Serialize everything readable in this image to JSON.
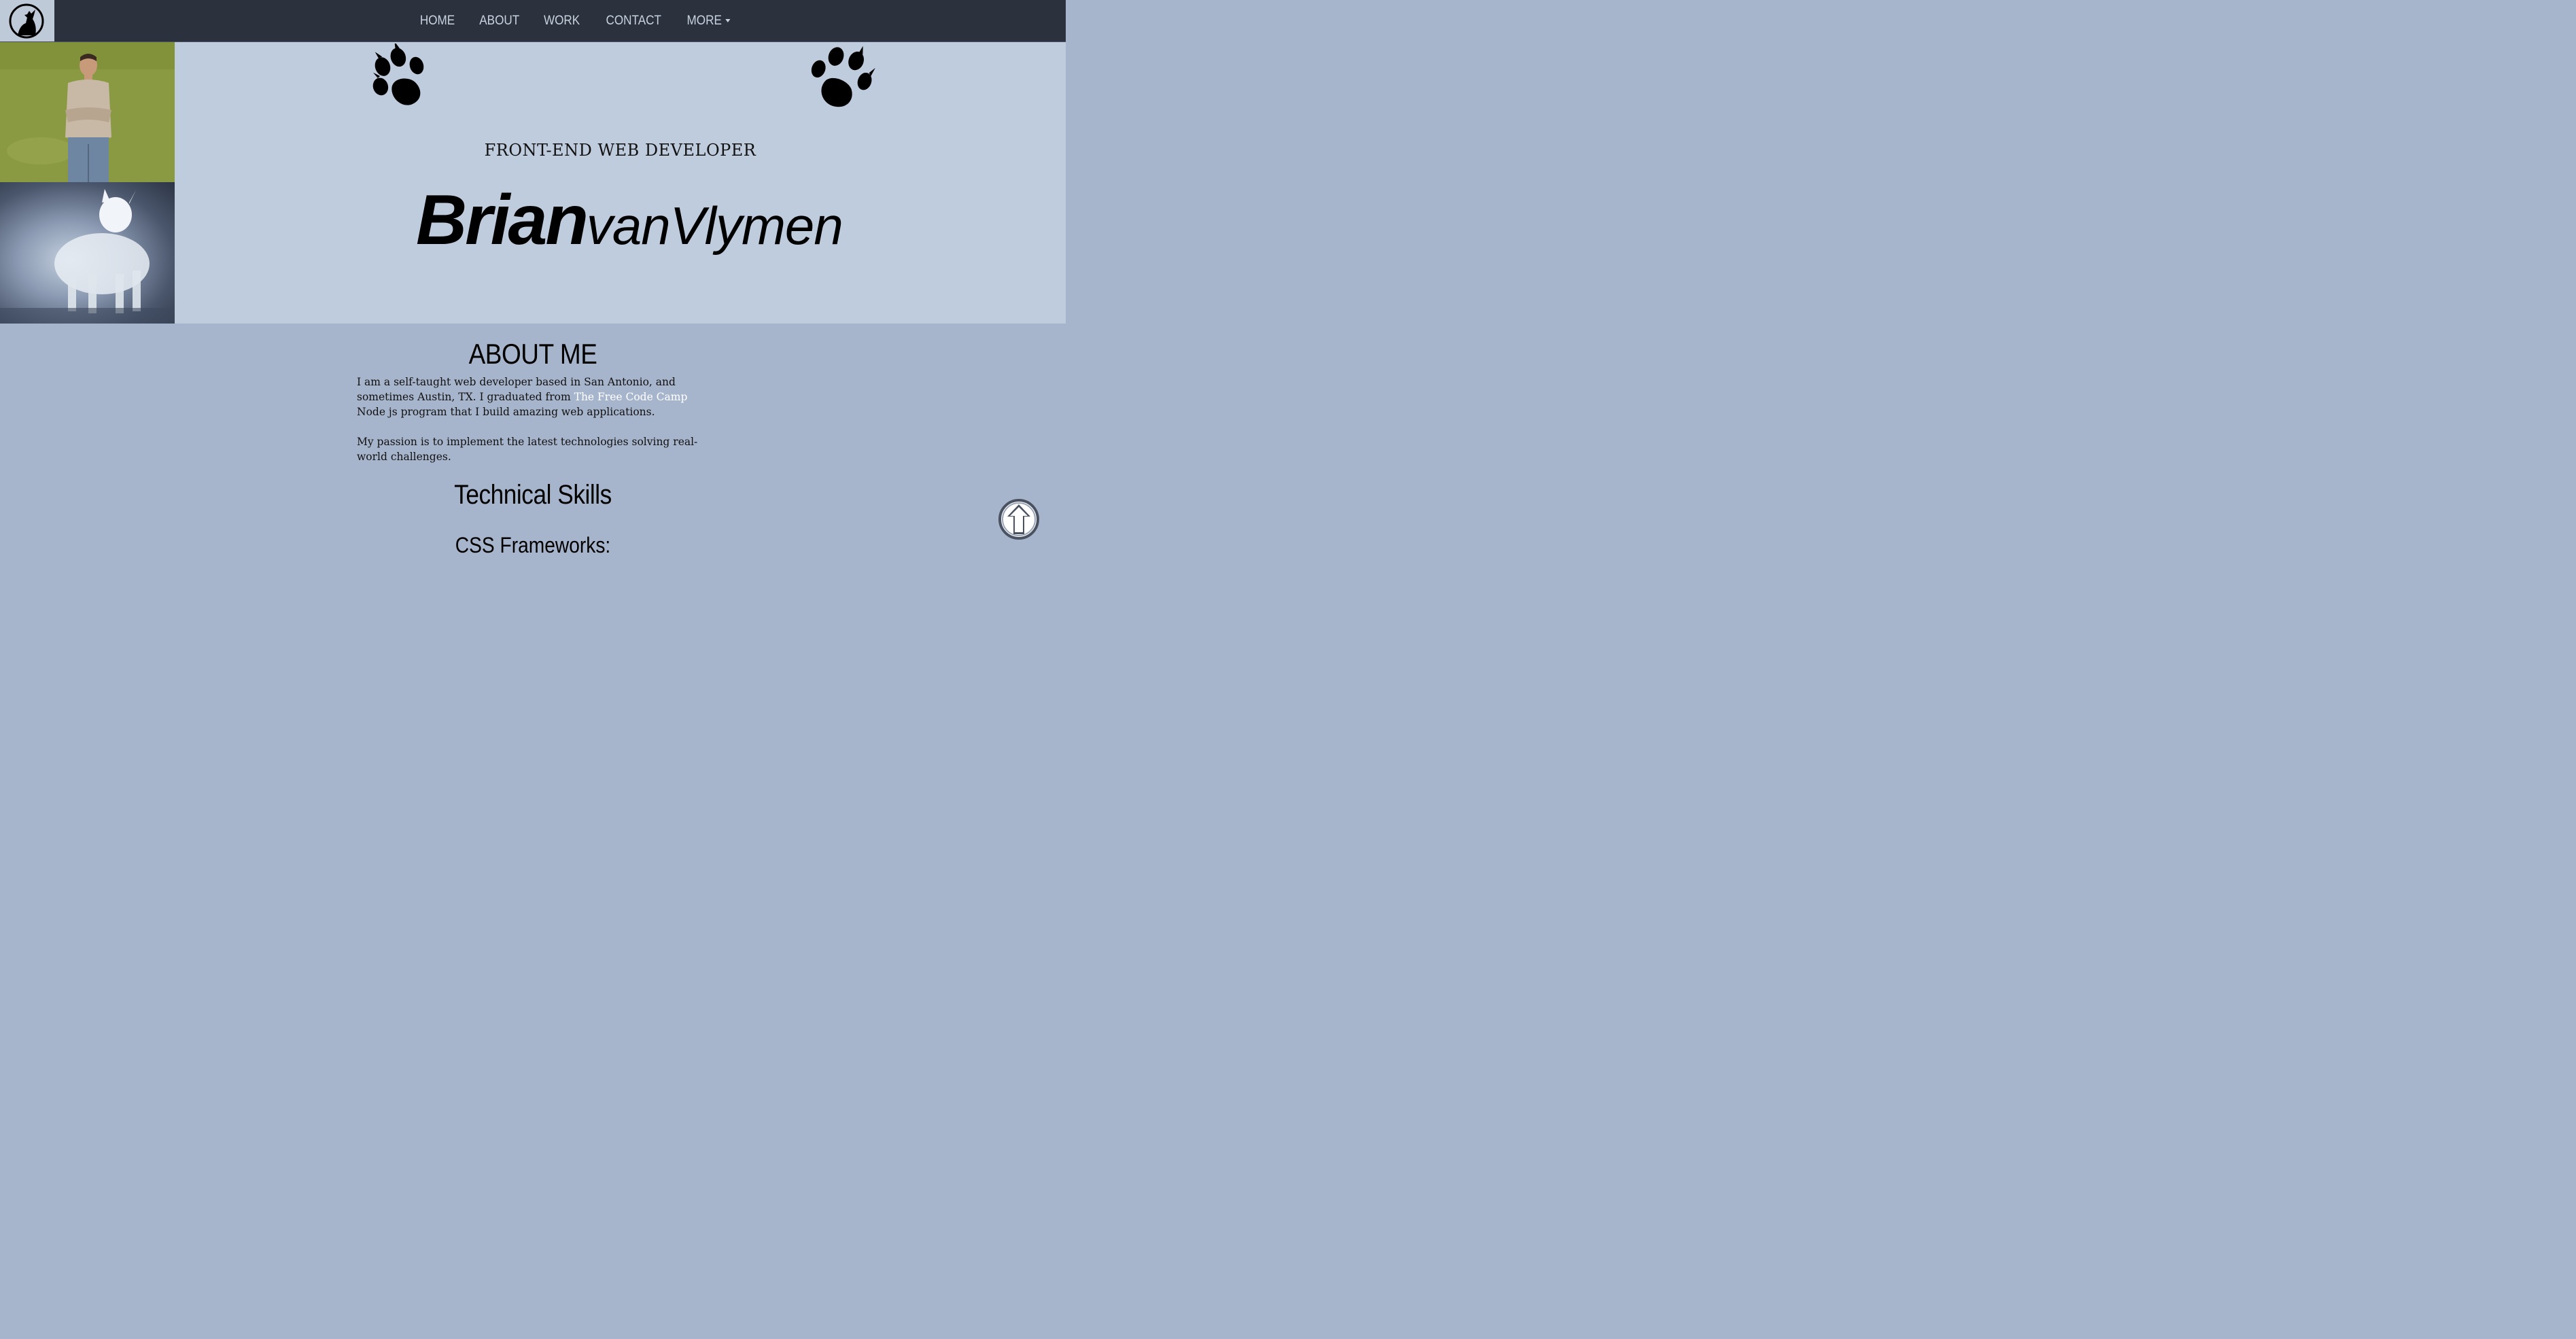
{
  "header": {
    "logo_icon": "howling-wolf-icon",
    "nav": [
      {
        "label": "HOME"
      },
      {
        "label": "ABOUT"
      },
      {
        "label": "WORK"
      },
      {
        "label": "CONTACT"
      },
      {
        "label": "MORE"
      }
    ],
    "nav_bg": "#2b313d",
    "nav_text_color": "#c9d2e0"
  },
  "hero": {
    "subtitle": "FRONT-END WEB DEVELOPER",
    "first_name": "Brian",
    "last_name": "vanVlymen",
    "bg": "#bfccdd",
    "left_paw_icon": "paw-print-icon",
    "right_paw_icon": "paw-print-icon"
  },
  "about": {
    "title": "ABOUT ME",
    "p1_before": "I am a self-taught web developer based in San Antonio, and sometimes Austin, TX. I graduated from ",
    "p1_link": "The Free Code Camp",
    "p1_after": " Node js program that I build amazing web applications.",
    "p2": "My passion is to implement the latest technologies solving real-world challenges.",
    "bg": "#a7b5cc"
  },
  "skills": {
    "title": "Technical Skills",
    "subtitle": "CSS Frameworks:"
  },
  "scroll_top_icon": "arrow-up-circle-icon"
}
